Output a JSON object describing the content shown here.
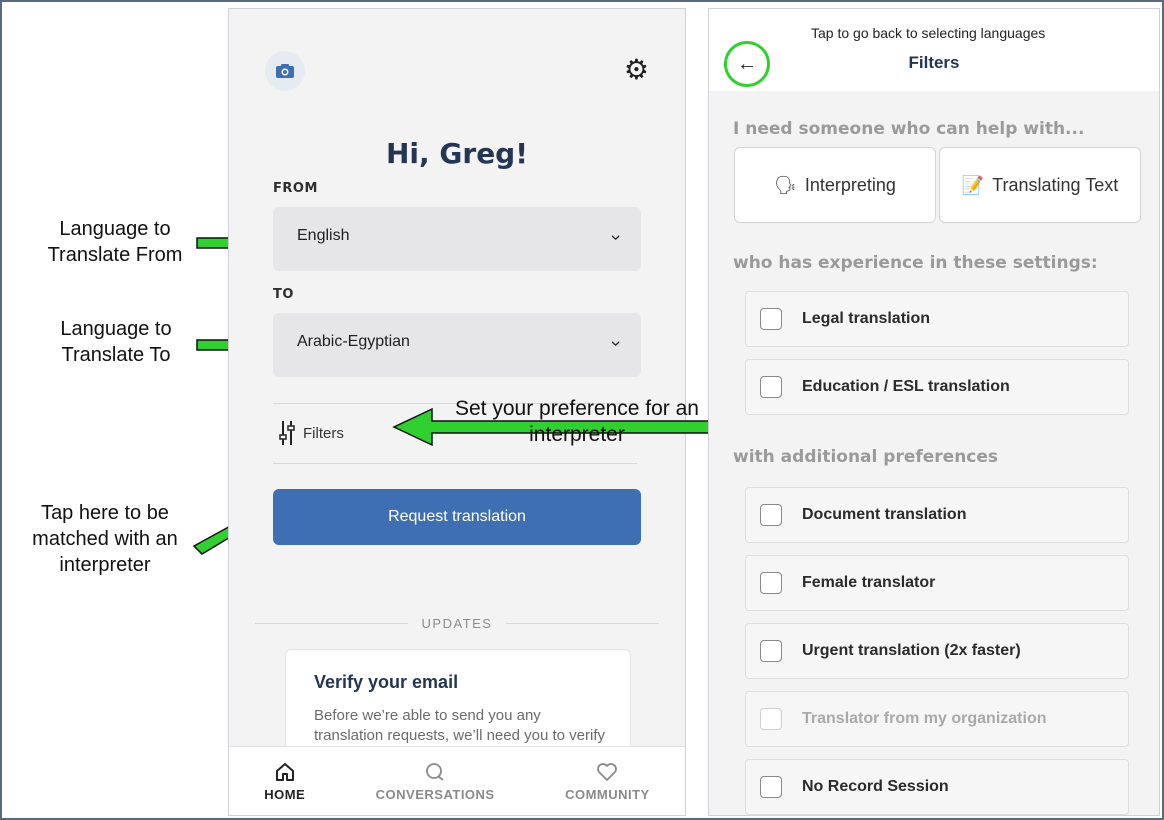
{
  "home": {
    "greeting": "Hi, Greg!",
    "from_label": "FROM",
    "from_value": "English",
    "to_label": "TO",
    "to_value": "Arabic-Egyptian",
    "filters_label": "Filters",
    "request_button": "Request translation",
    "updates_heading": "UPDATES",
    "card_title": "Verify your email",
    "card_body": "Before we’re able to send you any translation requests, we’ll need you to verify your email address."
  },
  "bottom_nav": [
    {
      "label": "HOME",
      "icon": "home-icon",
      "active": true
    },
    {
      "label": "CONVERSATIONS",
      "icon": "chat-icon",
      "active": false
    },
    {
      "label": "COMMUNITY",
      "icon": "heart-icon",
      "active": false
    }
  ],
  "annotations": {
    "from": "Language to Translate From",
    "to": "Language to Translate To",
    "filters": "Set your preference for an interpreter",
    "match": "Tap here to be matched with an interpreter",
    "back": "Tap to go back to selecting languages"
  },
  "filters": {
    "title": "Filters",
    "section1": "I need someone who can help with...",
    "btn_interpreting": "Interpreting",
    "btn_translating": "Translating Text",
    "section2": "who has experience in these settings:",
    "options_settings": [
      "Legal translation",
      "Education / ESL translation"
    ],
    "section3": "with additional preferences",
    "options_prefs": [
      "Document translation",
      "Female translator",
      "Urgent translation (2x faster)",
      "Translator from my organization",
      "No Record Session"
    ]
  },
  "colors": {
    "accent": "#3f6fb3",
    "arrow": "#2fd02f",
    "title": "#243654"
  }
}
